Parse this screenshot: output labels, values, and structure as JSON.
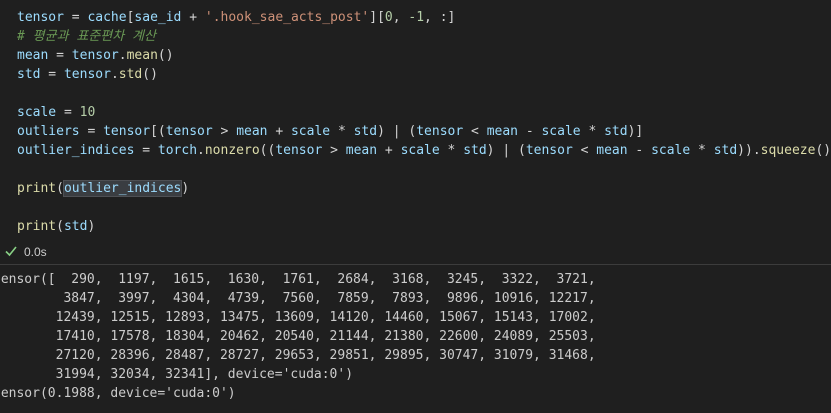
{
  "code_lines": [
    [
      {
        "t": "tensor",
        "c": "v"
      },
      {
        "t": " = ",
        "c": "o"
      },
      {
        "t": "cache",
        "c": "v"
      },
      {
        "t": "[",
        "c": "o"
      },
      {
        "t": "sae_id",
        "c": "v"
      },
      {
        "t": " + ",
        "c": "o"
      },
      {
        "t": "'.hook_sae_acts_post'",
        "c": "s"
      },
      {
        "t": "][",
        "c": "o"
      },
      {
        "t": "0",
        "c": "n"
      },
      {
        "t": ", ",
        "c": "o"
      },
      {
        "t": "-1",
        "c": "n"
      },
      {
        "t": ", :]",
        "c": "o"
      }
    ],
    [
      {
        "t": "# 평균과 표준편차 계산",
        "c": "c"
      }
    ],
    [
      {
        "t": "mean",
        "c": "v"
      },
      {
        "t": " = ",
        "c": "o"
      },
      {
        "t": "tensor",
        "c": "v"
      },
      {
        "t": ".",
        "c": "o"
      },
      {
        "t": "mean",
        "c": "f"
      },
      {
        "t": "()",
        "c": "o"
      }
    ],
    [
      {
        "t": "std",
        "c": "v"
      },
      {
        "t": " = ",
        "c": "o"
      },
      {
        "t": "tensor",
        "c": "v"
      },
      {
        "t": ".",
        "c": "o"
      },
      {
        "t": "std",
        "c": "f"
      },
      {
        "t": "()",
        "c": "o"
      }
    ],
    [
      {
        "t": "",
        "c": "o"
      }
    ],
    [
      {
        "t": "scale",
        "c": "v"
      },
      {
        "t": " = ",
        "c": "o"
      },
      {
        "t": "10",
        "c": "n"
      }
    ],
    [
      {
        "t": "outliers",
        "c": "v"
      },
      {
        "t": " = ",
        "c": "o"
      },
      {
        "t": "tensor",
        "c": "v"
      },
      {
        "t": "[(",
        "c": "o"
      },
      {
        "t": "tensor",
        "c": "v"
      },
      {
        "t": " > ",
        "c": "o"
      },
      {
        "t": "mean",
        "c": "v"
      },
      {
        "t": " + ",
        "c": "o"
      },
      {
        "t": "scale",
        "c": "v"
      },
      {
        "t": " * ",
        "c": "o"
      },
      {
        "t": "std",
        "c": "v"
      },
      {
        "t": ") | (",
        "c": "o"
      },
      {
        "t": "tensor",
        "c": "v"
      },
      {
        "t": " < ",
        "c": "o"
      },
      {
        "t": "mean",
        "c": "v"
      },
      {
        "t": " - ",
        "c": "o"
      },
      {
        "t": "scale",
        "c": "v"
      },
      {
        "t": " * ",
        "c": "o"
      },
      {
        "t": "std",
        "c": "v"
      },
      {
        "t": ")]",
        "c": "o"
      }
    ],
    [
      {
        "t": "outlier_indices",
        "c": "v"
      },
      {
        "t": " = ",
        "c": "o"
      },
      {
        "t": "torch",
        "c": "v"
      },
      {
        "t": ".",
        "c": "o"
      },
      {
        "t": "nonzero",
        "c": "f"
      },
      {
        "t": "((",
        "c": "o"
      },
      {
        "t": "tensor",
        "c": "v"
      },
      {
        "t": " > ",
        "c": "o"
      },
      {
        "t": "mean",
        "c": "v"
      },
      {
        "t": " + ",
        "c": "o"
      },
      {
        "t": "scale",
        "c": "v"
      },
      {
        "t": " * ",
        "c": "o"
      },
      {
        "t": "std",
        "c": "v"
      },
      {
        "t": ") | (",
        "c": "o"
      },
      {
        "t": "tensor",
        "c": "v"
      },
      {
        "t": " < ",
        "c": "o"
      },
      {
        "t": "mean",
        "c": "v"
      },
      {
        "t": " - ",
        "c": "o"
      },
      {
        "t": "scale",
        "c": "v"
      },
      {
        "t": " * ",
        "c": "o"
      },
      {
        "t": "std",
        "c": "v"
      },
      {
        "t": ")).",
        "c": "o"
      },
      {
        "t": "squeeze",
        "c": "f"
      },
      {
        "t": "()",
        "c": "o"
      }
    ],
    [
      {
        "t": "",
        "c": "o"
      }
    ],
    [
      {
        "t": "print",
        "c": "f"
      },
      {
        "t": "(",
        "c": "o"
      },
      {
        "t": "outlier_indices",
        "c": "v hl"
      },
      {
        "t": ")",
        "c": "o"
      }
    ],
    [
      {
        "t": "",
        "c": "o"
      }
    ],
    [
      {
        "t": "print",
        "c": "f"
      },
      {
        "t": "(",
        "c": "o"
      },
      {
        "t": "std",
        "c": "v"
      },
      {
        "t": ")",
        "c": "o"
      }
    ]
  ],
  "status": {
    "icon": "check-icon",
    "time": "0.0s",
    "check_color": "#89d185"
  },
  "output_lines": [
    "tensor([  290,  1197,  1615,  1630,  1761,  2684,  3168,  3245,  3322,  3721,",
    "         3847,  3997,  4304,  4739,  7560,  7859,  7893,  9896, 10916, 12217,",
    "        12439, 12515, 12893, 13475, 13609, 14120, 14460, 15067, 15143, 17002,",
    "        17410, 17578, 18304, 20462, 20540, 21144, 21380, 22600, 24089, 25503,",
    "        27120, 28396, 28487, 28727, 29653, 29851, 29895, 30747, 31079, 31468,",
    "        31994, 32034, 32341], device='cuda:0')",
    "tensor(0.1988, device='cuda:0')"
  ]
}
